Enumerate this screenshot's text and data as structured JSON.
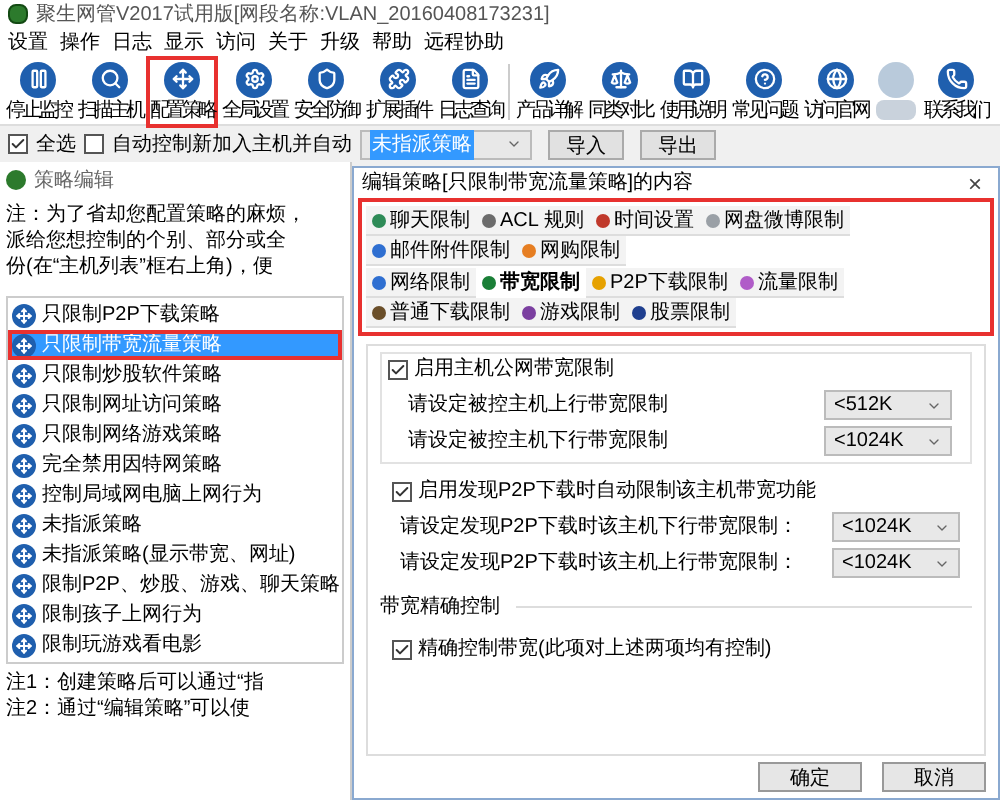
{
  "window": {
    "title": "聚生网管V2017试用版[网段名称:VLAN_20160408173231]"
  },
  "menu": [
    "设置",
    "操作",
    "日志",
    "显示",
    "访问",
    "关于",
    "升级",
    "帮助",
    "远程协助"
  ],
  "toolbar": {
    "groups": [
      [
        {
          "kind": "button",
          "label": "停止监控",
          "highlighted": false
        },
        {
          "kind": "button",
          "label": "扫描主机",
          "highlighted": false
        },
        {
          "kind": "button",
          "label": "配置策略",
          "highlighted": true
        },
        {
          "kind": "button",
          "label": "全局设置",
          "highlighted": false
        },
        {
          "kind": "button",
          "label": "安全防御",
          "highlighted": false
        },
        {
          "kind": "button",
          "label": "扩展插件",
          "highlighted": false
        },
        {
          "kind": "button",
          "label": "日志查询",
          "highlighted": false
        }
      ],
      [
        {
          "kind": "button",
          "label": "产品详解",
          "highlighted": false
        },
        {
          "kind": "button",
          "label": "同类对比",
          "highlighted": false
        },
        {
          "kind": "button",
          "label": "使用说明",
          "highlighted": false
        },
        {
          "kind": "button",
          "label": "常见问题",
          "highlighted": false
        },
        {
          "kind": "button",
          "label": "访问官网",
          "highlighted": false
        },
        {
          "kind": "blurred"
        },
        {
          "kind": "button",
          "label": "联系我们",
          "highlighted": false
        }
      ]
    ]
  },
  "filter_row": {
    "select_all": {
      "label": "全选",
      "checked": true
    },
    "auto_control": {
      "label": "自动控制新加入主机并自动",
      "checked": false
    },
    "policy_select": {
      "value": "未指派策略"
    },
    "buttons": [
      "导入",
      "导出"
    ]
  },
  "policy_panel": {
    "title": "策略编辑",
    "note_lines": [
      "注：为了省却您配置策略的麻烦，",
      "派给您想控制的个别、部分或全",
      "份(在“主机列表”框右上角)，便"
    ],
    "items": [
      {
        "label": "只限制P2P下载策略",
        "selected": false,
        "highlighted": false
      },
      {
        "label": "只限制带宽流量策略",
        "selected": true,
        "highlighted": true
      },
      {
        "label": "只限制炒股软件策略",
        "selected": false,
        "highlighted": false
      },
      {
        "label": "只限制网址访问策略",
        "selected": false,
        "highlighted": false
      },
      {
        "label": "只限制网络游戏策略",
        "selected": false,
        "highlighted": false
      },
      {
        "label": "完全禁用因特网策略",
        "selected": false,
        "highlighted": false
      },
      {
        "label": "控制局域网电脑上网行为",
        "selected": false,
        "highlighted": false
      },
      {
        "label": "未指派策略",
        "selected": false,
        "highlighted": false
      },
      {
        "label": "未指派策略(显示带宽、网址)",
        "selected": false,
        "highlighted": false
      },
      {
        "label": "限制P2P、炒股、游戏、聊天策略",
        "selected": false,
        "highlighted": false
      },
      {
        "label": "限制孩子上网行为",
        "selected": false,
        "highlighted": false
      },
      {
        "label": "限制玩游戏看电影",
        "selected": false,
        "highlighted": false
      }
    ],
    "footer_notes": [
      "注1：创建策略后可以通过“指",
      "注2：通过“编辑策略”可以使"
    ]
  },
  "dialog": {
    "title": "编辑策略[只限制带宽流量策略]的内容",
    "close": "×",
    "tabs_highlighted": true,
    "tab_rows": [
      [
        {
          "label": "聊天限制",
          "selected": false
        },
        {
          "label": "ACL 规则",
          "selected": false
        },
        {
          "label": "时间设置",
          "selected": false
        },
        {
          "label": "网盘微博限制",
          "selected": false
        },
        {
          "label": "邮件附件限制",
          "selected": false
        },
        {
          "label": "网购限制",
          "selected": false
        }
      ],
      [
        {
          "label": "网络限制",
          "selected": false
        },
        {
          "label": "带宽限制",
          "selected": true
        },
        {
          "label": "P2P下载限制",
          "selected": false
        },
        {
          "label": "流量限制",
          "selected": false
        },
        {
          "label": "普通下载限制",
          "selected": false
        },
        {
          "label": "游戏限制",
          "selected": false
        },
        {
          "label": "股票限制",
          "selected": false
        }
      ]
    ],
    "sections": [
      {
        "kind": "group",
        "label": "启用主机公网带宽限制",
        "checked": true,
        "rows": [
          {
            "label": "请设定被控主机上行带宽限制",
            "value": "<512K"
          },
          {
            "label": "请设定被控主机下行带宽限制",
            "value": "<1024K"
          }
        ]
      },
      {
        "kind": "check",
        "label": "启用发现P2P下载时自动限制该主机带宽功能",
        "checked": true,
        "rows": [
          {
            "label": "请设定发现P2P下载时该主机下行带宽限制：",
            "value": "<1024K"
          },
          {
            "label": "请设定发现P2P下载时该主机上行带宽限制：",
            "value": "<1024K"
          }
        ]
      },
      {
        "kind": "heading",
        "label": "带宽精确控制"
      },
      {
        "kind": "check",
        "label": "精确控制带宽(此项对上述两项均有控制)",
        "checked": true
      }
    ],
    "buttons": [
      "确定",
      "取消"
    ]
  }
}
